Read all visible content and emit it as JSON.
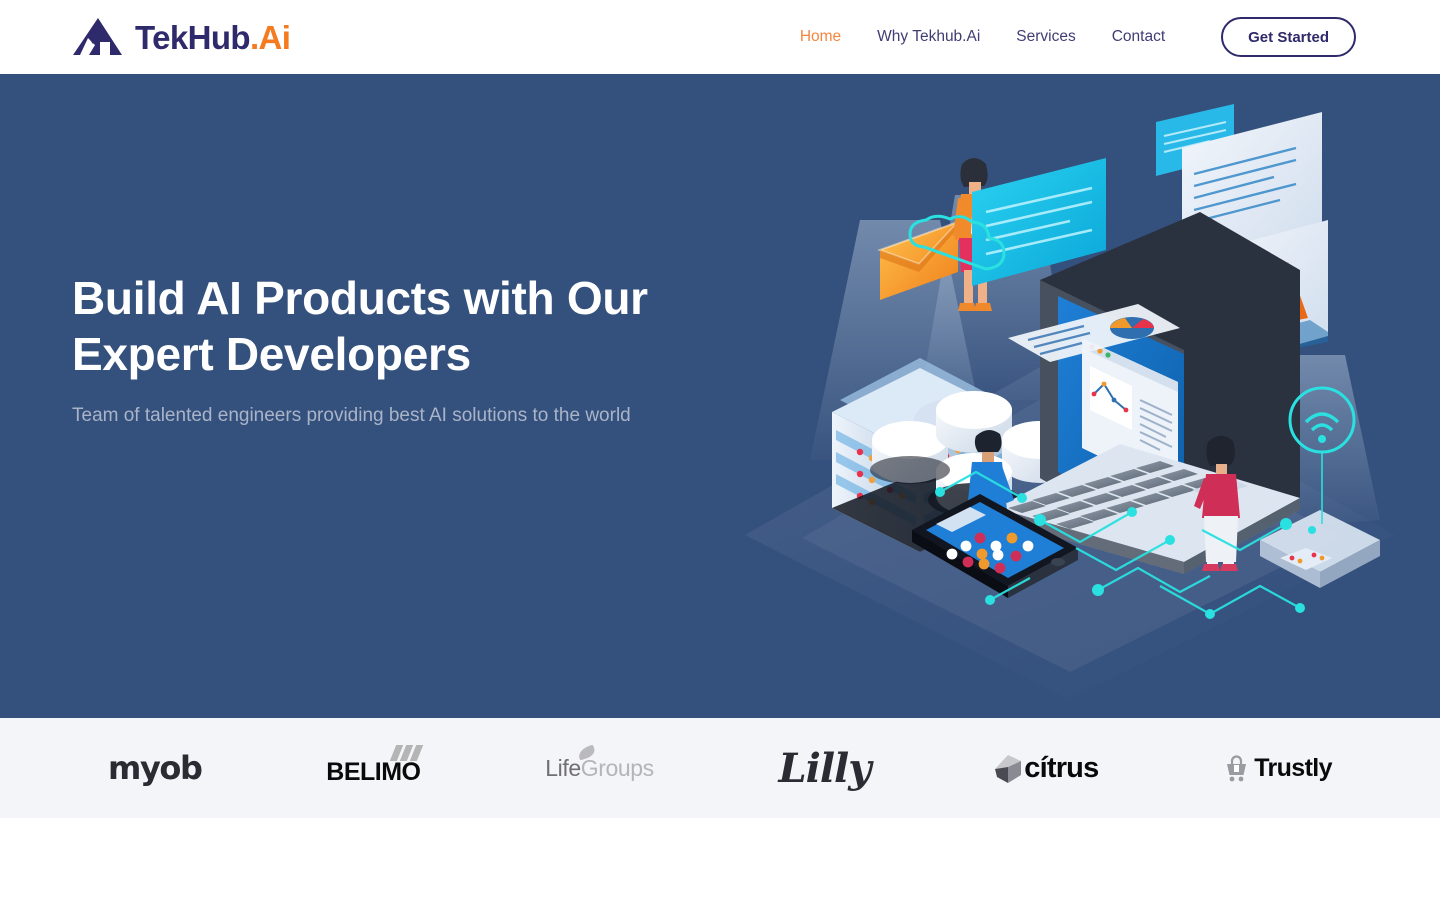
{
  "header": {
    "logo": {
      "mark_icon": "mountain-a-logo-icon",
      "text_primary": "TekHub",
      "text_accent": ".Ai",
      "primary_color": "#2e2a6b",
      "accent_color": "#f47b20"
    },
    "nav": [
      {
        "label": "Home",
        "active": true
      },
      {
        "label": "Why Tekhub.Ai",
        "active": false
      },
      {
        "label": "Services",
        "active": false
      },
      {
        "label": "Contact",
        "active": false
      }
    ],
    "cta": {
      "label": "Get Started"
    }
  },
  "hero": {
    "title": "Build AI Products with Our Expert Developers",
    "subtitle": "Team of talented engineers providing best AI solutions to the world",
    "background_color": "#34507c",
    "illustration": {
      "name": "isometric-ai-technology-illustration",
      "elements": [
        "laptop",
        "server-rack",
        "smartphone",
        "cloud-outline-icon",
        "wifi-icon",
        "envelope-icon",
        "pie-chart",
        "line-chart",
        "area-chart-card",
        "database-cylinders",
        "circuit-traces",
        "person-standing-woman",
        "person-man-at-laptop",
        "person-woman-pink"
      ]
    }
  },
  "clients": {
    "background_color": "#f4f5f9",
    "logos": [
      {
        "name": "myob",
        "label": "myob"
      },
      {
        "name": "belimo",
        "label": "BELIMO"
      },
      {
        "name": "lifegroups",
        "label_part1": "Life",
        "label_part2": "Groups"
      },
      {
        "name": "lilly",
        "label": "Lilly"
      },
      {
        "name": "citrus",
        "label": "cítrus"
      },
      {
        "name": "trustly",
        "label": "Trustly"
      }
    ]
  }
}
